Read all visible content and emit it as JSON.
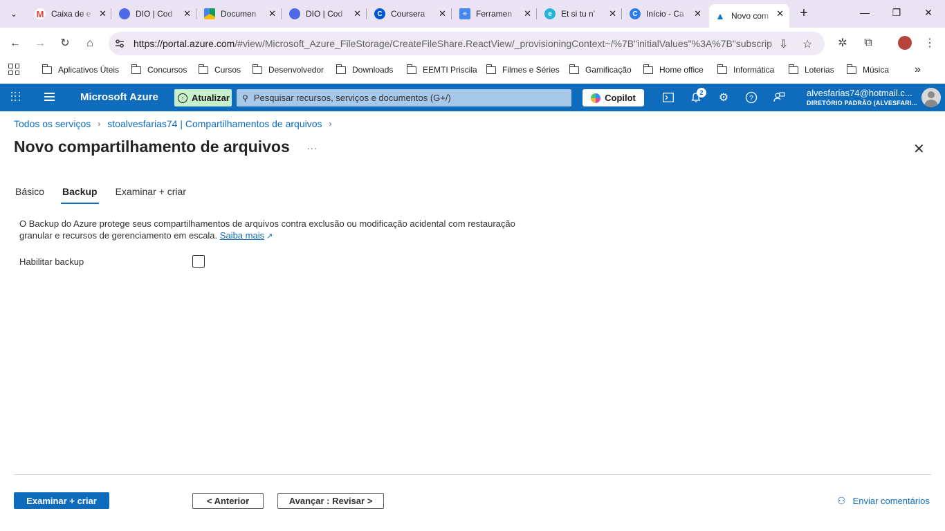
{
  "browser": {
    "tabs": [
      {
        "title": "Caixa de e",
        "favicon": "gmail-icon",
        "color": "#ea4335"
      },
      {
        "title": "DIO | Cod",
        "favicon": "dio-icon",
        "color": "#4f6ae8"
      },
      {
        "title": "Documen",
        "favicon": "drive-icon",
        "color": "#fbbc04"
      },
      {
        "title": "DIO | Cod",
        "favicon": "dio-icon",
        "color": "#4f6ae8"
      },
      {
        "title": "Coursera",
        "favicon": "coursera-icon",
        "color": "#0056d2"
      },
      {
        "title": "Ferramen",
        "favicon": "docs-icon",
        "color": "#4285f4"
      },
      {
        "title": "Et si tu n'",
        "favicon": "edge-icon",
        "color": "#1fb6d8"
      },
      {
        "title": "Início - Ca",
        "favicon": "canva-icon",
        "color": "#2b7de9"
      },
      {
        "title": "Novo com",
        "favicon": "azure-icon",
        "color": "#0078d4",
        "active": true
      }
    ],
    "url_host": "https://portal.azure.com",
    "url_rest": "/#view/Microsoft_Azure_FileStorage/CreateFileShare.ReactView/_provisioningContext~/%7B\"initialValues\"%3A%7B\"subscrip...",
    "bookmarks": [
      "Aplicativos Úteis",
      "Concursos",
      "Cursos",
      "Desenvolvedor",
      "Downloads",
      "EEMTI Priscila",
      "Filmes e Séries",
      "Gamificação",
      "Home office",
      "Informática",
      "Loterias",
      "Música"
    ]
  },
  "azure": {
    "brand": "Microsoft Azure",
    "upgrade_label": "Atualizar",
    "search_placeholder": "Pesquisar recursos, serviços e documentos (G+/)",
    "copilot_label": "Copilot",
    "notification_count": "2",
    "user_email": "alvesfarias74@hotmail.c...",
    "user_directory": "DIRETÓRIO PADRÃO (ALVESFARI..."
  },
  "page": {
    "breadcrumb": [
      "Todos os serviços",
      "stoalvesfarias74 | Compartilhamentos de arquivos"
    ],
    "title": "Novo compartilhamento de arquivos",
    "more_label": "...",
    "tabs": [
      "Básico",
      "Backup",
      "Examinar + criar"
    ],
    "active_tab": "Backup",
    "description": "O Backup do Azure protege seus compartilhamentos de arquivos contra exclusão ou modificação acidental com restauração granular e recursos de gerenciamento em escala.",
    "learn_more": "Saiba mais",
    "backup_label": "Habilitar backup",
    "backup_enabled": false
  },
  "footer": {
    "primary_button": "Examinar + criar",
    "prev_button": "< Anterior",
    "next_button": "Avançar : Revisar >",
    "feedback": "Enviar comentários"
  }
}
